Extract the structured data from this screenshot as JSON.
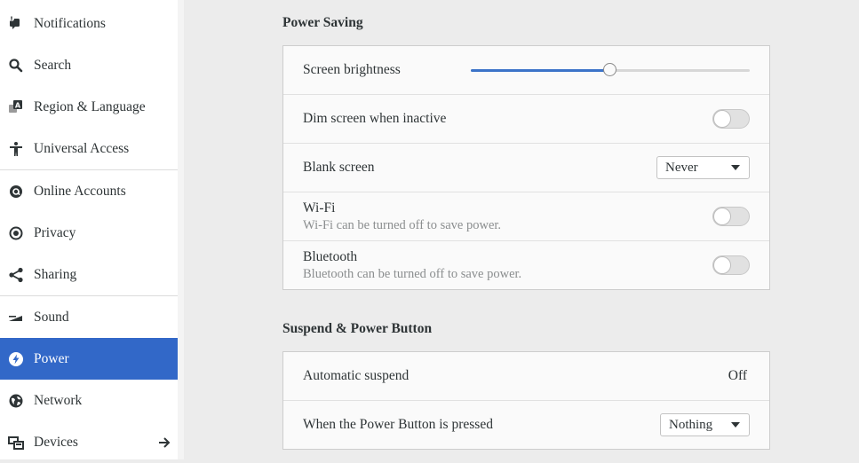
{
  "sidebar": {
    "items": [
      {
        "label": "Notifications",
        "icon": "notifications-icon"
      },
      {
        "label": "Search",
        "icon": "search-icon"
      },
      {
        "label": "Region & Language",
        "icon": "region-language-icon"
      },
      {
        "label": "Universal Access",
        "icon": "universal-access-icon"
      },
      {
        "label": "Online Accounts",
        "icon": "online-accounts-icon"
      },
      {
        "label": "Privacy",
        "icon": "privacy-icon"
      },
      {
        "label": "Sharing",
        "icon": "sharing-icon"
      },
      {
        "label": "Sound",
        "icon": "sound-icon"
      },
      {
        "label": "Power",
        "icon": "power-icon",
        "selected": true
      },
      {
        "label": "Network",
        "icon": "network-icon"
      },
      {
        "label": "Devices",
        "icon": "devices-icon",
        "has_submenu": true
      }
    ]
  },
  "power_saving": {
    "title": "Power Saving",
    "screen_brightness": {
      "label": "Screen brightness",
      "value_fraction": 0.5
    },
    "dim_screen": {
      "label": "Dim screen when inactive",
      "on": false
    },
    "blank_screen": {
      "label": "Blank screen",
      "value": "Never"
    },
    "wifi": {
      "label": "Wi-Fi",
      "description": "Wi-Fi can be turned off to save power.",
      "on": false
    },
    "bluetooth": {
      "label": "Bluetooth",
      "description": "Bluetooth can be turned off to save power.",
      "on": false
    }
  },
  "suspend": {
    "title": "Suspend & Power Button",
    "automatic_suspend": {
      "label": "Automatic suspend",
      "value": "Off"
    },
    "power_button": {
      "label": "When the Power Button is pressed",
      "value": "Nothing"
    }
  },
  "colors": {
    "accent": "#3268c8",
    "slider_fill": "#3b73c8"
  }
}
